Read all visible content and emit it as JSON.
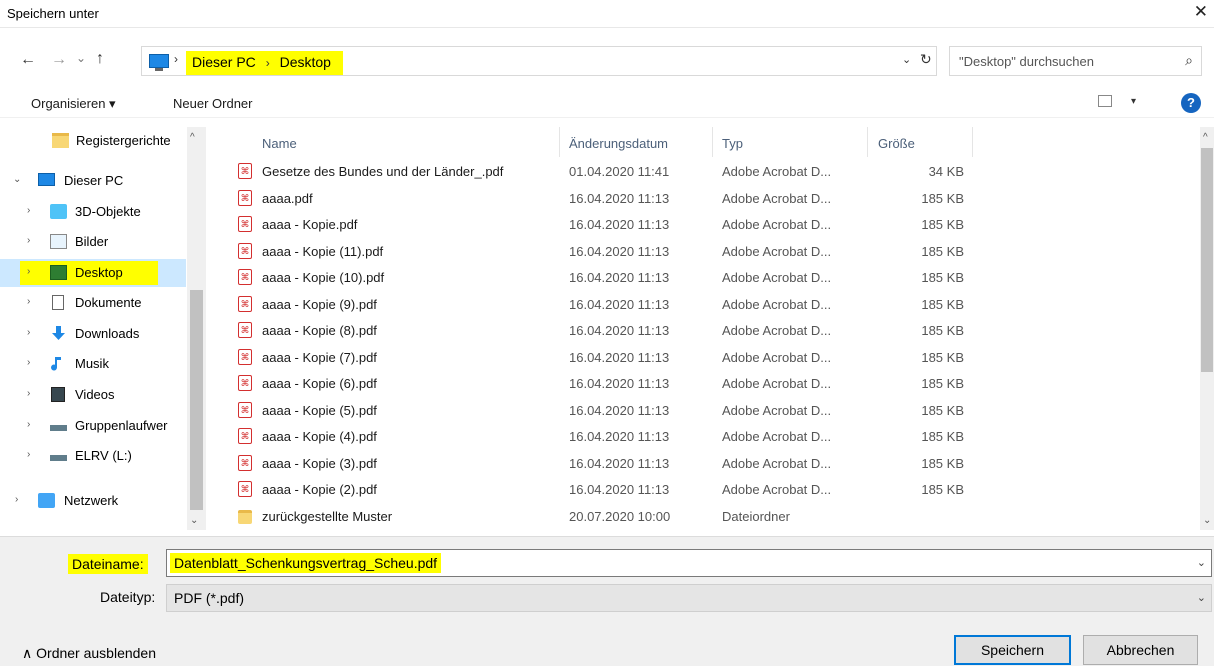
{
  "window": {
    "title": "Speichern unter",
    "close_label": "✕"
  },
  "nav": {
    "back_label": "←",
    "forward_label": "→",
    "recent_label": "⌄",
    "up_label": "↑",
    "breadcrumbs": [
      "Dieser PC",
      "Desktop"
    ],
    "crumb_separator": "›",
    "refresh_label": "↻",
    "dropdown_label": "⌄",
    "search_placeholder": "\"Desktop\" durchsuchen",
    "search_icon": "⌕"
  },
  "toolbar": {
    "organize_label": "Organisieren ▾",
    "new_folder_label": "Neuer Ordner",
    "view_dropdown": "▾",
    "help_label": "?"
  },
  "sidebar": {
    "items": [
      {
        "label": "Registergerichte",
        "icon": "folder-icon",
        "chevron": "",
        "level": 2
      },
      {
        "label": "Dieser PC",
        "icon": "pc-icon",
        "chevron": "⌄",
        "level": 1
      },
      {
        "label": "3D-Objekte",
        "icon": "3d-objects-icon",
        "chevron": "›",
        "level": 2
      },
      {
        "label": "Bilder",
        "icon": "pictures-icon",
        "chevron": "›",
        "level": 2
      },
      {
        "label": "Desktop",
        "icon": "desktop-icon",
        "chevron": "›",
        "level": 2,
        "selected": true
      },
      {
        "label": "Dokumente",
        "icon": "documents-icon",
        "chevron": "›",
        "level": 2
      },
      {
        "label": "Downloads",
        "icon": "downloads-icon",
        "chevron": "›",
        "level": 2
      },
      {
        "label": "Musik",
        "icon": "music-icon",
        "chevron": "›",
        "level": 2
      },
      {
        "label": "Videos",
        "icon": "videos-icon",
        "chevron": "›",
        "level": 2
      },
      {
        "label": "Gruppenlaufwer",
        "icon": "network-drive-icon",
        "chevron": "›",
        "level": 2
      },
      {
        "label": "ELRV (L:)",
        "icon": "network-drive-icon",
        "chevron": "›",
        "level": 2
      },
      {
        "label": "Netzwerk",
        "icon": "network-icon",
        "chevron": "›",
        "level": 1
      }
    ],
    "scroll_up": "^",
    "scroll_down": "⌄"
  },
  "filelist": {
    "columns": [
      "Name",
      "Änderungsdatum",
      "Typ",
      "Größe"
    ],
    "rows": [
      {
        "name": "Gesetze des Bundes und der Länder_.pdf",
        "date": "01.04.2020 11:41",
        "type": "Adobe Acrobat D...",
        "size": "34 KB",
        "kind": "pdf"
      },
      {
        "name": "aaaa.pdf",
        "date": "16.04.2020 11:13",
        "type": "Adobe Acrobat D...",
        "size": "185 KB",
        "kind": "pdf"
      },
      {
        "name": "aaaa - Kopie.pdf",
        "date": "16.04.2020 11:13",
        "type": "Adobe Acrobat D...",
        "size": "185 KB",
        "kind": "pdf"
      },
      {
        "name": "aaaa - Kopie (11).pdf",
        "date": "16.04.2020 11:13",
        "type": "Adobe Acrobat D...",
        "size": "185 KB",
        "kind": "pdf"
      },
      {
        "name": "aaaa - Kopie (10).pdf",
        "date": "16.04.2020 11:13",
        "type": "Adobe Acrobat D...",
        "size": "185 KB",
        "kind": "pdf"
      },
      {
        "name": "aaaa - Kopie (9).pdf",
        "date": "16.04.2020 11:13",
        "type": "Adobe Acrobat D...",
        "size": "185 KB",
        "kind": "pdf"
      },
      {
        "name": "aaaa - Kopie (8).pdf",
        "date": "16.04.2020 11:13",
        "type": "Adobe Acrobat D...",
        "size": "185 KB",
        "kind": "pdf"
      },
      {
        "name": "aaaa - Kopie (7).pdf",
        "date": "16.04.2020 11:13",
        "type": "Adobe Acrobat D...",
        "size": "185 KB",
        "kind": "pdf"
      },
      {
        "name": "aaaa - Kopie (6).pdf",
        "date": "16.04.2020 11:13",
        "type": "Adobe Acrobat D...",
        "size": "185 KB",
        "kind": "pdf"
      },
      {
        "name": "aaaa - Kopie (5).pdf",
        "date": "16.04.2020 11:13",
        "type": "Adobe Acrobat D...",
        "size": "185 KB",
        "kind": "pdf"
      },
      {
        "name": "aaaa - Kopie (4).pdf",
        "date": "16.04.2020 11:13",
        "type": "Adobe Acrobat D...",
        "size": "185 KB",
        "kind": "pdf"
      },
      {
        "name": "aaaa - Kopie (3).pdf",
        "date": "16.04.2020 11:13",
        "type": "Adobe Acrobat D...",
        "size": "185 KB",
        "kind": "pdf"
      },
      {
        "name": "aaaa - Kopie (2).pdf",
        "date": "16.04.2020 11:13",
        "type": "Adobe Acrobat D...",
        "size": "185 KB",
        "kind": "pdf"
      },
      {
        "name": "zurückgestellte Muster",
        "date": "20.07.2020 10:00",
        "type": "Dateiordner",
        "size": "",
        "kind": "folder"
      }
    ]
  },
  "form": {
    "filename_label": "Dateiname:",
    "filename_value": "Datenblatt_Schenkungsvertrag_Scheu.pdf",
    "filetype_label": "Dateityp:",
    "filetype_value": "PDF (*.pdf)",
    "dropdown_arrow": "⌄"
  },
  "footer": {
    "hide_folders_label": "∧  Ordner ausblenden",
    "save_label": "Speichern",
    "cancel_label": "Abbrechen"
  },
  "colors": {
    "highlight": "#ffff00",
    "selected_bg": "#cce8ff",
    "accent": "#0078d7",
    "pdf_red": "#d32f2f"
  }
}
